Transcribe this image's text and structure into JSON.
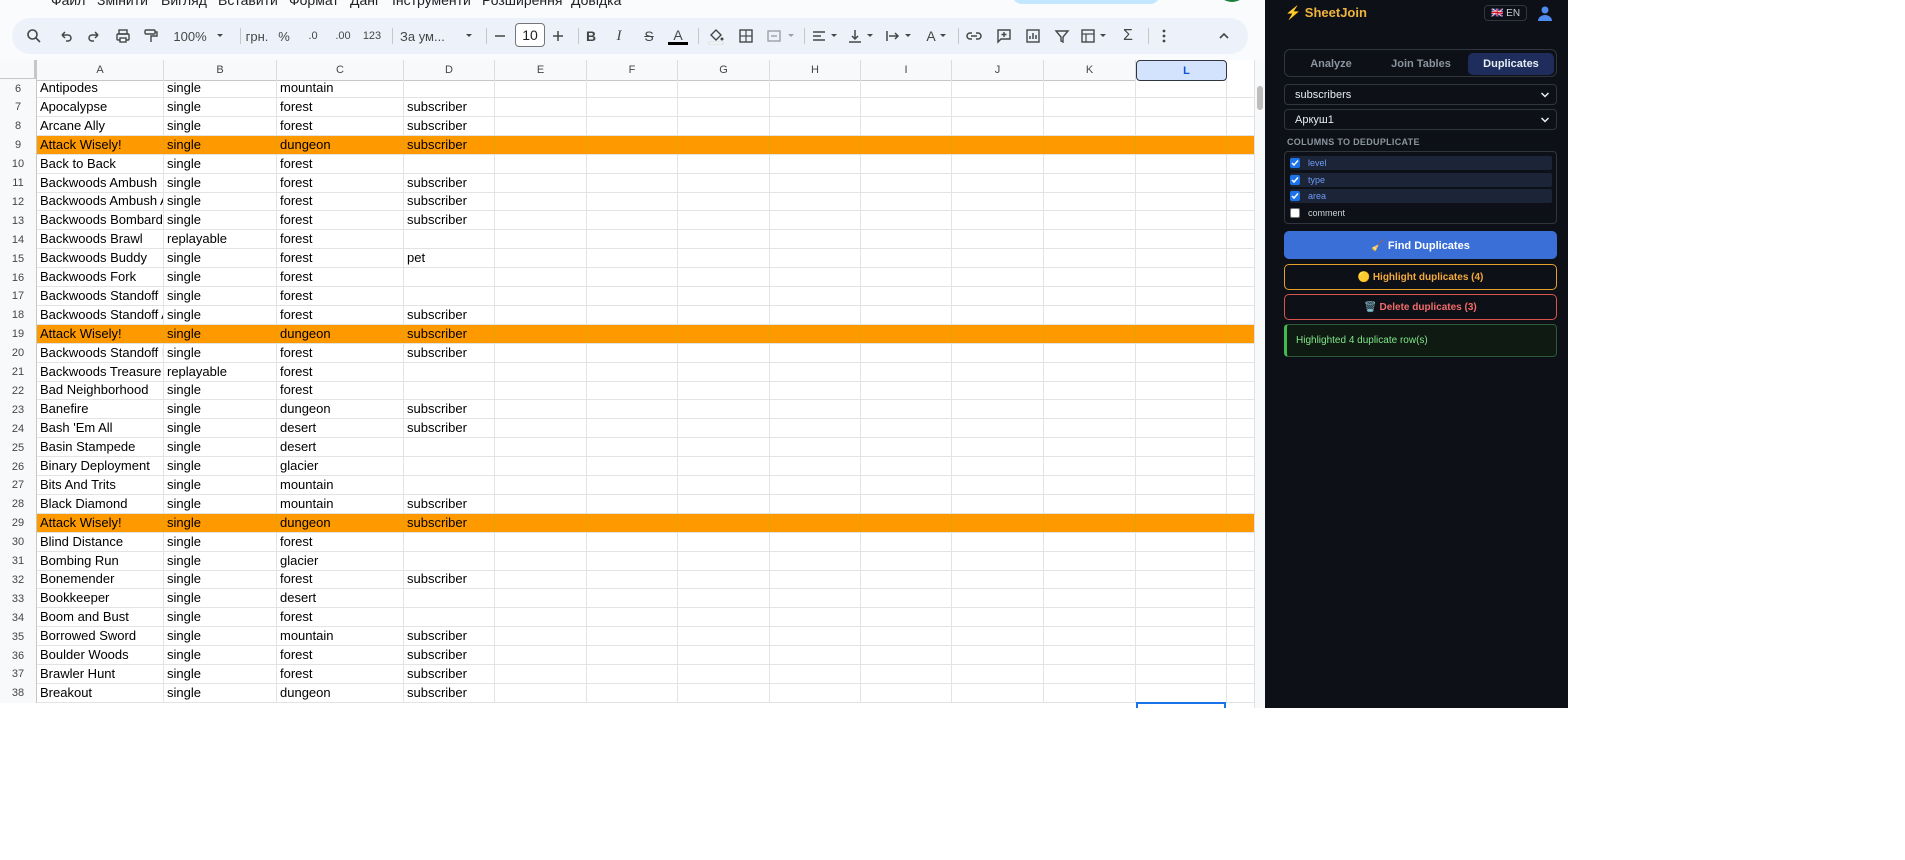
{
  "menu": {
    "items": [
      "Файл",
      "Змінити",
      "Вигляд",
      "Вставити",
      "Формат",
      "Дані",
      "Інструменти",
      "Розширення",
      "Довідка"
    ]
  },
  "toolbar": {
    "zoom": "100%",
    "currency": "грн.",
    "percent": "%",
    "dec_decrease": ".0",
    "dec_increase": ".00",
    "number_format": "123",
    "font_name": "За ум...",
    "font_size": "10"
  },
  "columns": [
    "A",
    "B",
    "C",
    "D",
    "E",
    "F",
    "G",
    "H",
    "I",
    "J",
    "K",
    "L"
  ],
  "selected_column": "L",
  "rows": [
    {
      "n": "6",
      "a": "Antipodes",
      "b": "single",
      "c": "mountain",
      "d": "",
      "hl": false
    },
    {
      "n": "7",
      "a": "Apocalypse",
      "b": "single",
      "c": "forest",
      "d": "subscriber",
      "hl": false
    },
    {
      "n": "8",
      "a": "Arcane Ally",
      "b": "single",
      "c": "forest",
      "d": "subscriber",
      "hl": false
    },
    {
      "n": "9",
      "a": "Attack Wisely!",
      "b": "single",
      "c": "dungeon",
      "d": "subscriber",
      "hl": true
    },
    {
      "n": "10",
      "a": "Back to Back",
      "b": "single",
      "c": "forest",
      "d": "",
      "hl": false
    },
    {
      "n": "11",
      "a": "Backwoods Ambush",
      "b": "single",
      "c": "forest",
      "d": "subscriber",
      "hl": false
    },
    {
      "n": "12",
      "a": "Backwoods Ambush A",
      "b": "single",
      "c": "forest",
      "d": "subscriber",
      "hl": false
    },
    {
      "n": "13",
      "a": "Backwoods Bombardie",
      "b": "single",
      "c": "forest",
      "d": "subscriber",
      "hl": false
    },
    {
      "n": "14",
      "a": "Backwoods Brawl",
      "b": "replayable",
      "c": "forest",
      "d": "",
      "hl": false
    },
    {
      "n": "15",
      "a": "Backwoods Buddy",
      "b": "single",
      "c": "forest",
      "d": "pet",
      "hl": false
    },
    {
      "n": "16",
      "a": "Backwoods Fork",
      "b": "single",
      "c": "forest",
      "d": "",
      "hl": false
    },
    {
      "n": "17",
      "a": "Backwoods Standoff",
      "b": "single",
      "c": "forest",
      "d": "",
      "hl": false
    },
    {
      "n": "18",
      "a": "Backwoods Standoff A",
      "b": "single",
      "c": "forest",
      "d": "subscriber",
      "hl": false
    },
    {
      "n": "19",
      "a": "Attack Wisely!",
      "b": "single",
      "c": "dungeon",
      "d": "subscriber",
      "hl": true
    },
    {
      "n": "20",
      "a": "Backwoods Standoff B",
      "b": "single",
      "c": "forest",
      "d": "subscriber",
      "hl": false
    },
    {
      "n": "21",
      "a": "Backwoods Treasure",
      "b": "replayable",
      "c": "forest",
      "d": "",
      "hl": false
    },
    {
      "n": "22",
      "a": "Bad Neighborhood",
      "b": "single",
      "c": "forest",
      "d": "",
      "hl": false
    },
    {
      "n": "23",
      "a": "Banefire",
      "b": "single",
      "c": "dungeon",
      "d": "subscriber",
      "hl": false
    },
    {
      "n": "24",
      "a": "Bash 'Em All",
      "b": "single",
      "c": "desert",
      "d": "subscriber",
      "hl": false
    },
    {
      "n": "25",
      "a": "Basin Stampede",
      "b": "single",
      "c": "desert",
      "d": "",
      "hl": false
    },
    {
      "n": "26",
      "a": "Binary Deployment",
      "b": "single",
      "c": "glacier",
      "d": "",
      "hl": false
    },
    {
      "n": "27",
      "a": "Bits And Trits",
      "b": "single",
      "c": "mountain",
      "d": "",
      "hl": false
    },
    {
      "n": "28",
      "a": "Black Diamond",
      "b": "single",
      "c": "mountain",
      "d": "subscriber",
      "hl": false
    },
    {
      "n": "29",
      "a": "Attack Wisely!",
      "b": "single",
      "c": "dungeon",
      "d": "subscriber",
      "hl": true
    },
    {
      "n": "30",
      "a": "Blind Distance",
      "b": "single",
      "c": "forest",
      "d": "",
      "hl": false
    },
    {
      "n": "31",
      "a": "Bombing Run",
      "b": "single",
      "c": "glacier",
      "d": "",
      "hl": false
    },
    {
      "n": "32",
      "a": "Bonemender",
      "b": "single",
      "c": "forest",
      "d": "subscriber",
      "hl": false
    },
    {
      "n": "33",
      "a": "Bookkeeper",
      "b": "single",
      "c": "desert",
      "d": "",
      "hl": false
    },
    {
      "n": "34",
      "a": "Boom and Bust",
      "b": "single",
      "c": "forest",
      "d": "",
      "hl": false
    },
    {
      "n": "35",
      "a": "Borrowed Sword",
      "b": "single",
      "c": "mountain",
      "d": "subscriber",
      "hl": false
    },
    {
      "n": "36",
      "a": "Boulder Woods",
      "b": "single",
      "c": "forest",
      "d": "subscriber",
      "hl": false
    },
    {
      "n": "37",
      "a": "Brawler Hunt",
      "b": "single",
      "c": "forest",
      "d": "subscriber",
      "hl": false
    },
    {
      "n": "38",
      "a": "Breakout",
      "b": "single",
      "c": "dungeon",
      "d": "subscriber",
      "hl": false
    }
  ],
  "panel": {
    "brand": "⚡ SheetJoin",
    "lang": "🇬🇧 EN",
    "tabs": [
      {
        "label": "Analyze",
        "active": false
      },
      {
        "label": "Join Tables",
        "active": false
      },
      {
        "label": "Duplicates",
        "active": true
      }
    ],
    "sheet_select": "subscribers",
    "tab_select": "Аркуш1",
    "columns_title": "COLUMNS TO DEDUPLICATE",
    "columns": [
      {
        "label": "level",
        "checked": true
      },
      {
        "label": "type",
        "checked": true
      },
      {
        "label": "area",
        "checked": true
      },
      {
        "label": "comment",
        "checked": false
      }
    ],
    "find_button": "🧹 Find Duplicates",
    "highlight_button": "🟡 Highlight duplicates (4)",
    "delete_button": "🗑️ Delete duplicates (3)",
    "status": "Highlighted 4 duplicate row(s)"
  },
  "colors": {
    "highlight": "#ff9900",
    "panel_bg": "#0d1117",
    "accent": "#3a6fd8"
  }
}
